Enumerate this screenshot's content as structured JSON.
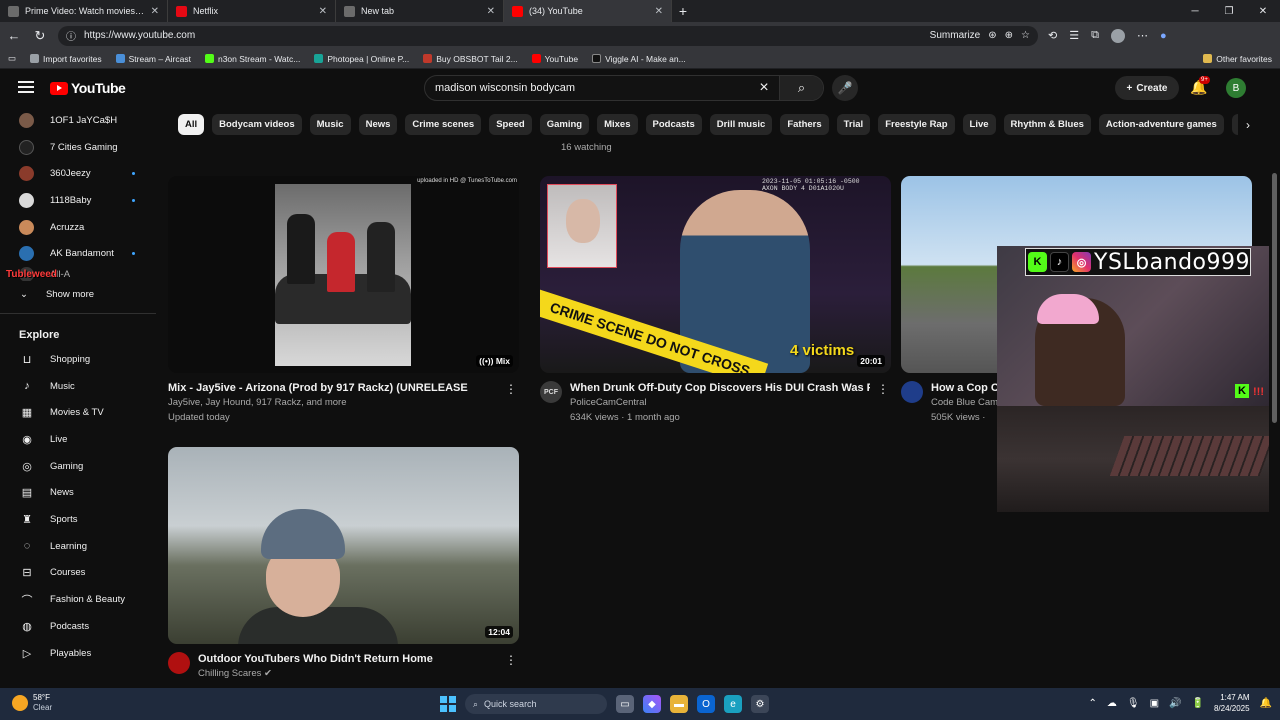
{
  "browser": {
    "tabs": [
      {
        "title": "Prime Video: Watch movies, TV sh",
        "color": "#6b6b6b",
        "active": false
      },
      {
        "title": "Netflix",
        "color": "#e50914",
        "active": false
      },
      {
        "title": "New tab",
        "color": "#6b6b6b",
        "active": false
      },
      {
        "title": "(34) YouTube",
        "color": "#ff0000",
        "active": true
      }
    ],
    "new_tab_symbol": "+",
    "url": "https://www.youtube.com",
    "summarize_label": "Summarize",
    "bookmarks": [
      "Import favorites",
      "Stream – Aircast",
      "n3on Stream - Watc...",
      "Photopea | Online P...",
      "Buy OBSBOT Tail 2...",
      "YouTube",
      "Viggle AI - Make an..."
    ],
    "other_favorites": "Other favorites"
  },
  "youtube": {
    "logo_text": "YouTube",
    "search_query": "madison wisconsin bodycam",
    "create_label": "Create",
    "notification_badge": "9+",
    "account_initial": "B",
    "subscriptions": [
      {
        "name": "1OF1 JaYCa$H",
        "color": "#7a5a48",
        "dot": false
      },
      {
        "name": "7 Cities Gaming",
        "color": "#222222",
        "dot": false
      },
      {
        "name": "360Jeezy",
        "color": "#8a3b2b",
        "dot": true
      },
      {
        "name": "1118Baby",
        "color": "#d9d9d9",
        "dot": true
      },
      {
        "name": "Acruzza",
        "color": "#c98a5a",
        "dot": false
      },
      {
        "name": "AK Bandamont",
        "color": "#2a6fb0",
        "dot": true
      },
      {
        "name": "All-A",
        "color": "#444444",
        "dot": false
      }
    ],
    "show_more": "Show more",
    "explore_heading": "Explore",
    "explore": [
      {
        "label": "Shopping",
        "icon": "shopping-bag-icon",
        "glyph": "👜"
      },
      {
        "label": "Music",
        "icon": "music-note-icon",
        "glyph": "♪"
      },
      {
        "label": "Movies & TV",
        "icon": "film-icon",
        "glyph": "▦"
      },
      {
        "label": "Live",
        "icon": "live-icon",
        "glyph": "◉"
      },
      {
        "label": "Gaming",
        "icon": "gamepad-icon",
        "glyph": "◎"
      },
      {
        "label": "News",
        "icon": "news-icon",
        "glyph": "▤"
      },
      {
        "label": "Sports",
        "icon": "trophy-icon",
        "glyph": "♜"
      },
      {
        "label": "Learning",
        "icon": "lightbulb-icon",
        "glyph": "◌"
      },
      {
        "label": "Courses",
        "icon": "courses-icon",
        "glyph": "⊟"
      },
      {
        "label": "Fashion & Beauty",
        "icon": "hanger-icon",
        "glyph": "⌒"
      },
      {
        "label": "Podcasts",
        "icon": "podcast-icon",
        "glyph": "◍"
      },
      {
        "label": "Playables",
        "icon": "playables-icon",
        "glyph": "▷"
      }
    ],
    "overlay_username_sidebar": "Tubleweed",
    "chips": [
      "All",
      "Bodycam videos",
      "Music",
      "News",
      "Crime scenes",
      "Speed",
      "Gaming",
      "Mixes",
      "Podcasts",
      "Drill music",
      "Fathers",
      "Trial",
      "Freestyle Rap",
      "Live",
      "Rhythm & Blues",
      "Action-adventure games",
      "Recen"
    ],
    "watching_text": "16 watching",
    "videos": [
      {
        "title": "Mix - Jay5ive - Arizona (Prod by 917 Rackz) (UNRELEASED)",
        "line1": "Jay5ive, Jay Hound, 917 Rackz, and more",
        "line2": "Updated today",
        "badge": "Mix",
        "watermark": "uploaded in HD @ TunesToTube.com"
      },
      {
        "title": "When Drunk Off-Duty Cop Discovers His DUI Crash Was Fatal",
        "line1": "PoliceCamCentral",
        "line2": "634K views · 1 month ago",
        "badge": "20:01",
        "overlay_text": "4 victims",
        "tape_text": "CRIME SCENE DO NOT CROSS",
        "stamp": "2023-11-05 01:05:16 -0500 AXON BODY 4 D01A1020U",
        "channel_icon_text": "PCF",
        "channel_color": "#3a3a3a"
      },
      {
        "title": "How a Cop Ch",
        "line1": "Code Blue Cam",
        "line2": "505K views ·",
        "channel_color": "#1f3d8a"
      },
      {
        "title": "Outdoor YouTubers Who Didn't Return Home",
        "line1": "Chilling Scares",
        "line2": "",
        "badge": "12:04",
        "channel_color": "#b01010"
      }
    ]
  },
  "stream_overlay": {
    "username": "YSLbando999",
    "kick_letter": "K",
    "badge_number": "!!!"
  },
  "taskbar": {
    "temperature": "58°F",
    "condition": "Clear",
    "search_placeholder": "Quick search",
    "time": "1:47 AM",
    "date": "8/24/2025"
  }
}
